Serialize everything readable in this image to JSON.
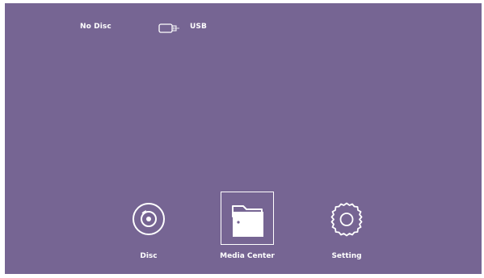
{
  "status_bar": {
    "disc_status": "No Disc",
    "usb_label": "USB",
    "usb_icon": "usb-drive-icon"
  },
  "menu": {
    "selected": "Media Center",
    "items": [
      {
        "label": "Disc",
        "icon": "disc-icon"
      },
      {
        "label": "Media Center",
        "icon": "folder-icon"
      },
      {
        "label": "Setting",
        "icon": "gear-icon"
      }
    ]
  },
  "colors": {
    "background": "#766593",
    "foreground": "#ffffff"
  }
}
